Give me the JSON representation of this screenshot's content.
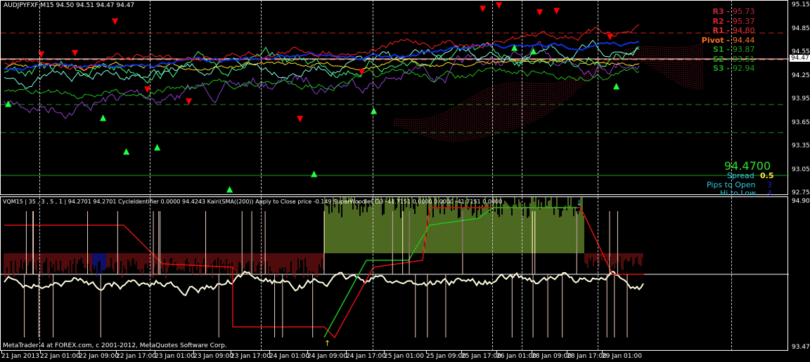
{
  "header": {
    "symbol_info": "AUDJPYFXF,M15  94.50 94.51 94.47 94.47"
  },
  "pivots": [
    {
      "label": "R3 -",
      "value": "95.73",
      "color": "#c0283a"
    },
    {
      "label": "R2 -",
      "value": "95.37",
      "color": "#e0203a"
    },
    {
      "label": "R1 -",
      "value": "94.80",
      "color": "#e63030"
    },
    {
      "label": "Pivot -",
      "value": "94.44",
      "color": "#ff7020"
    },
    {
      "label": "S1 -",
      "value": "93.87",
      "color": "#1ea01e"
    },
    {
      "label": "S2 -",
      "value": "93.51",
      "color": "#1ea01e"
    },
    {
      "label": "S3 -",
      "value": "92.94",
      "color": "#1ea01e"
    }
  ],
  "info": {
    "price": "94.4700",
    "spread_label": "Spread",
    "spread_value": "0.5",
    "pips_label": "Pips to Open",
    "pips_value": "3",
    "hilo_label": "Hi to Low",
    "hilo_value": "4"
  },
  "price_axis": [
    "95.15",
    "94.85",
    "94.55",
    "94.25",
    "93.95",
    "93.65",
    "93.35",
    "93.05",
    "92.75"
  ],
  "current_price": "94.47",
  "sub": {
    "title": "VQM15 | 35 , 3 , 5 , 1  |  94.2701 94.2701  CycleIdentifier 0.0000 94.4243  Kairi(SMA((200)) Apply to Close price -0.149  SuperWoodieCCI3 -41.7151 0.0000 0.0000 -41.7151 0.0000",
    "axis_max": "94.9022",
    "axis_min": "93.477"
  },
  "copyright": "MetaTrader 4 at FOREX.com, c 2001-2012, MetaQuotes Software Corp.",
  "time_axis": [
    "21 Jan 2013",
    "22 Jan 01:00",
    "22 Jan 09:00",
    "22 Jan 17:00",
    "23 Jan 01:00",
    "23 Jan 09:00",
    "23 Jan 17:00",
    "24 Jan 01:00",
    "24 Jan 09:00",
    "24 Jan 17:00",
    "25 Jan 01:00",
    "25 Jan 09:00",
    "25 Jan 17:00",
    "26 Jan 01:00",
    "28 Jan 09:00",
    "28 Jan 17:00",
    "29 Jan 01:00"
  ],
  "colors": {
    "resistance": "#ff2020",
    "support": "#1ea01e",
    "price_line": "#ffffff"
  }
}
